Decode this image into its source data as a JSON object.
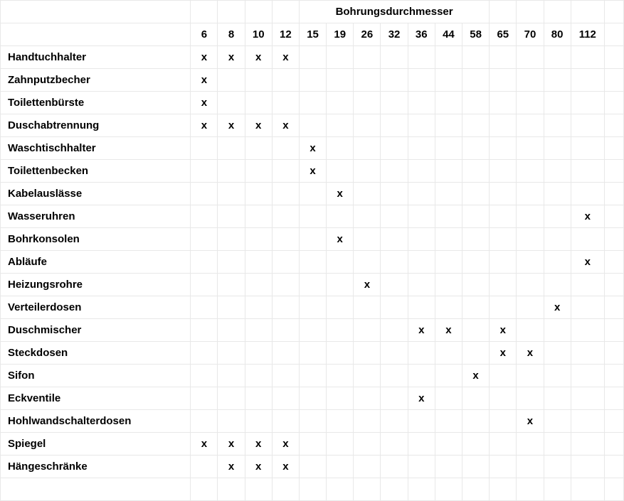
{
  "chart_data": {
    "type": "table",
    "title": "Bohrungsdurchmesser",
    "columns": [
      6,
      8,
      10,
      12,
      15,
      19,
      26,
      32,
      36,
      44,
      58,
      65,
      70,
      80,
      112
    ],
    "rows": [
      {
        "label": "Handtuchhalter",
        "marks": [
          6,
          8,
          10,
          12
        ]
      },
      {
        "label": "Zahnputzbecher",
        "marks": [
          6
        ]
      },
      {
        "label": "Toilettenbürste",
        "marks": [
          6
        ]
      },
      {
        "label": "Duschabtrennung",
        "marks": [
          6,
          8,
          10,
          12
        ]
      },
      {
        "label": "Waschtischhalter",
        "marks": [
          15
        ]
      },
      {
        "label": "Toilettenbecken",
        "marks": [
          15
        ]
      },
      {
        "label": "Kabelauslässe",
        "marks": [
          19
        ]
      },
      {
        "label": "Wasseruhren",
        "marks": [
          112
        ]
      },
      {
        "label": "Bohrkonsolen",
        "marks": [
          19
        ]
      },
      {
        "label": "Abläufe",
        "marks": [
          112
        ]
      },
      {
        "label": "Heizungsrohre",
        "marks": [
          26
        ]
      },
      {
        "label": "Verteilerdosen",
        "marks": [
          80
        ]
      },
      {
        "label": "Duschmischer",
        "marks": [
          36,
          44,
          65
        ]
      },
      {
        "label": "Steckdosen",
        "marks": [
          65,
          70
        ]
      },
      {
        "label": "Sifon",
        "marks": [
          58
        ]
      },
      {
        "label": "Eckventile",
        "marks": [
          36
        ]
      },
      {
        "label": "Hohlwandschalterdosen",
        "marks": [
          70
        ]
      },
      {
        "label": "Spiegel",
        "marks": [
          6,
          8,
          10,
          12
        ]
      },
      {
        "label": "Hängeschränke",
        "marks": [
          8,
          10,
          12
        ]
      }
    ],
    "mark_symbol": "x"
  }
}
